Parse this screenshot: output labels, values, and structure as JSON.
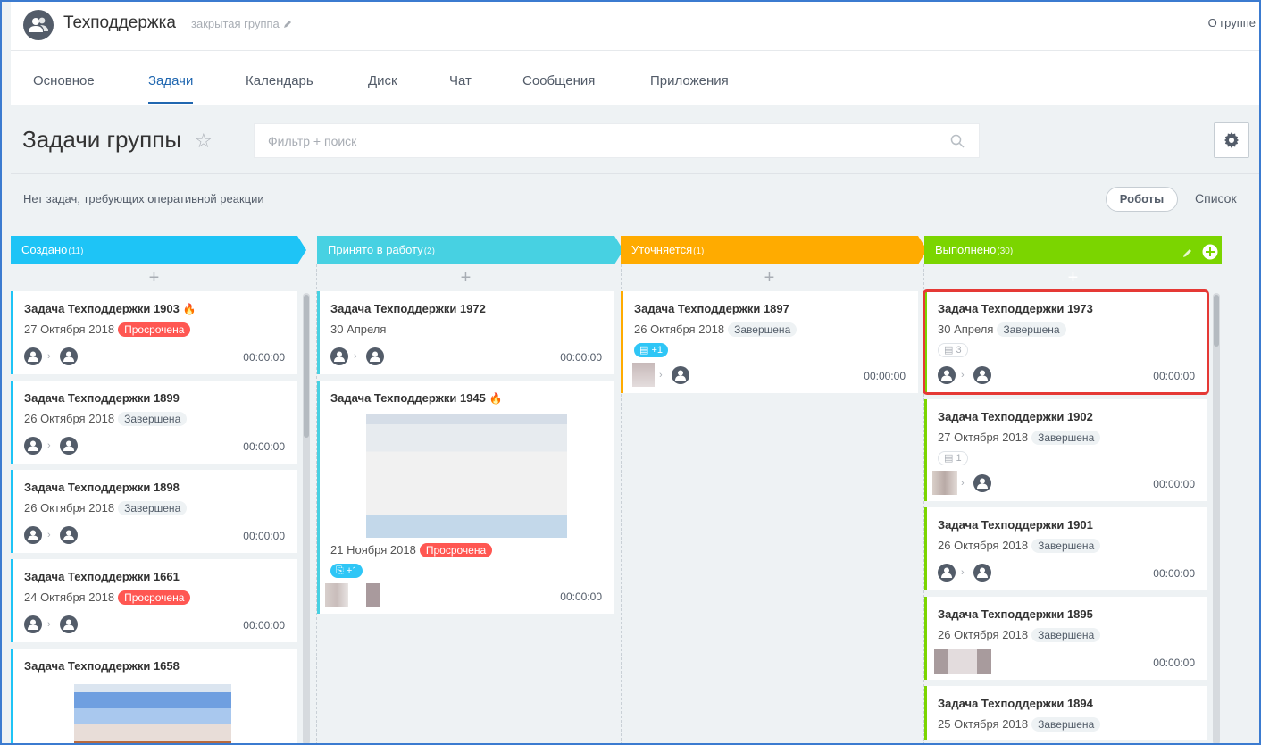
{
  "header": {
    "title": "Техподдержка",
    "group_type": "закрытая группа",
    "about": "О группе"
  },
  "tabs": [
    {
      "label": "Основное"
    },
    {
      "label": "Задачи"
    },
    {
      "label": "Календарь"
    },
    {
      "label": "Диск"
    },
    {
      "label": "Чат"
    },
    {
      "label": "Сообщения"
    },
    {
      "label": "Приложения"
    }
  ],
  "page": {
    "title": "Задачи группы",
    "filter_placeholder": "Фильтр + поиск"
  },
  "info": {
    "text": "Нет задач, требующих оперативной реакции",
    "robots": "Роботы",
    "list": "Список"
  },
  "colors": {
    "created": "#1ec4f6",
    "in_work": "#47d1e2",
    "clarify": "#ffab00",
    "done": "#7bd500",
    "overdue": "#ff5752",
    "accent": "#2067b0"
  },
  "columns": [
    {
      "name": "Создано",
      "count": "(11)",
      "cards": [
        {
          "title": "Задача Техподдержки 1903",
          "date": "27 Октября 2018",
          "status": "Просрочена",
          "timer": "00:00:00"
        },
        {
          "title": "Задача Техподдержки 1899",
          "date": "26 Октября 2018",
          "status": "Завершена",
          "timer": "00:00:00"
        },
        {
          "title": "Задача Техподдержки 1898",
          "date": "26 Октября 2018",
          "status": "Завершена",
          "timer": "00:00:00"
        },
        {
          "title": "Задача Техподдержки 1661",
          "date": "24 Октября 2018",
          "status": "Просрочена",
          "timer": "00:00:00"
        },
        {
          "title": "Задача Техподдержки 1658"
        }
      ]
    },
    {
      "name": "Принято в работу",
      "count": "(2)",
      "cards": [
        {
          "title": "Задача Техподдержки 1972",
          "date": "30 Апреля",
          "timer": "00:00:00"
        },
        {
          "title": "Задача Техподдержки 1945",
          "date": "21 Ноября 2018",
          "status": "Просрочена",
          "chip": "+1",
          "timer": "00:00:00"
        }
      ]
    },
    {
      "name": "Уточняется",
      "count": "(1)",
      "cards": [
        {
          "title": "Задача Техподдержки 1897",
          "date": "26 Октября 2018",
          "status": "Завершена",
          "chip": "+1",
          "timer": "00:00:00"
        }
      ]
    },
    {
      "name": "Выполнено",
      "count": "(30)",
      "cards": [
        {
          "title": "Задача Техподдержки 1973",
          "date": "30 Апреля",
          "status": "Завершена",
          "chip": "3",
          "timer": "00:00:00"
        },
        {
          "title": "Задача Техподдержки 1902",
          "date": "27 Октября 2018",
          "status": "Завершена",
          "chip": "1",
          "timer": "00:00:00"
        },
        {
          "title": "Задача Техподдержки 1901",
          "date": "26 Октября 2018",
          "status": "Завершена",
          "timer": "00:00:00"
        },
        {
          "title": "Задача Техподдержки 1895",
          "date": "26 Октября 2018",
          "status": "Завершена",
          "timer": "00:00:00"
        },
        {
          "title": "Задача Техподдержки 1894",
          "date": "25 Октября 2018",
          "status": "Завершена"
        }
      ]
    }
  ]
}
